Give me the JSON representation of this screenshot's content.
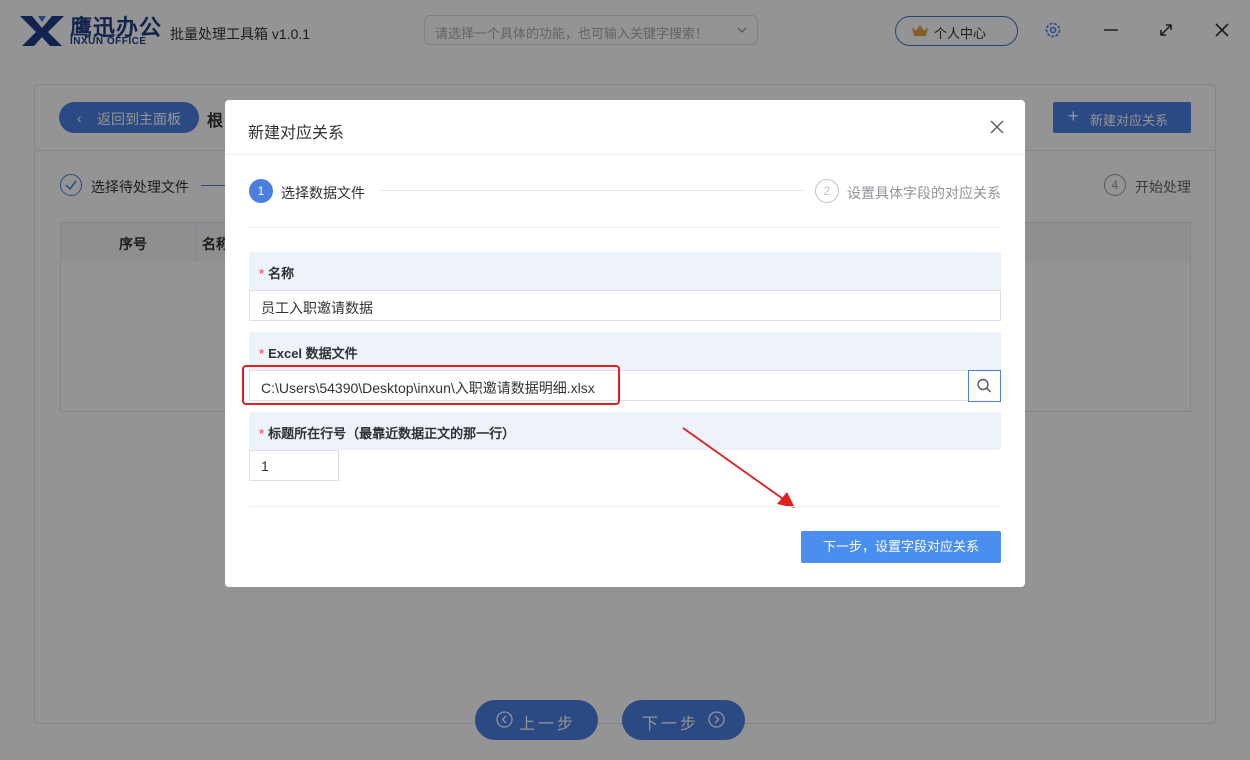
{
  "app": {
    "logo_cn": "鹰迅办公",
    "logo_en": "INXUN OFFICE",
    "title": "批量处理工具箱 v1.0.1",
    "search_placeholder": "请选择一个具体的功能，也可输入关键字搜索！",
    "personal_center": "个人中心"
  },
  "background_page": {
    "back_button": "返回到主面板",
    "page_title_fragment": "根",
    "new_relation_button": "新建对应关系",
    "steps": [
      {
        "label": "选择待处理文件"
      },
      {
        "number": "4",
        "label": "开始处理"
      }
    ],
    "table_headers": [
      "序号",
      "名称"
    ],
    "prev_button": "上一步",
    "next_button": "下一步"
  },
  "dialog": {
    "title": "新建对应关系",
    "steps": [
      {
        "number": "1",
        "label": "选择数据文件",
        "active": true
      },
      {
        "number": "2",
        "label": "设置具体字段的对应关系",
        "active": false
      }
    ],
    "fields": {
      "name_label": "名称",
      "name_value": "员工入职邀请数据",
      "excel_label": "Excel 数据文件",
      "excel_value": "C:\\Users\\54390\\Desktop\\inxun\\入职邀请数据明细.xlsx",
      "header_row_label": "标题所在行号（最靠近数据正文的那一行）",
      "header_row_value": "1"
    },
    "required_mark": "*",
    "primary_button": "下一步，设置字段对应关系"
  },
  "colors": {
    "accent": "#4a7fe0",
    "highlight": "#e02020",
    "required": "#f56c6c"
  }
}
